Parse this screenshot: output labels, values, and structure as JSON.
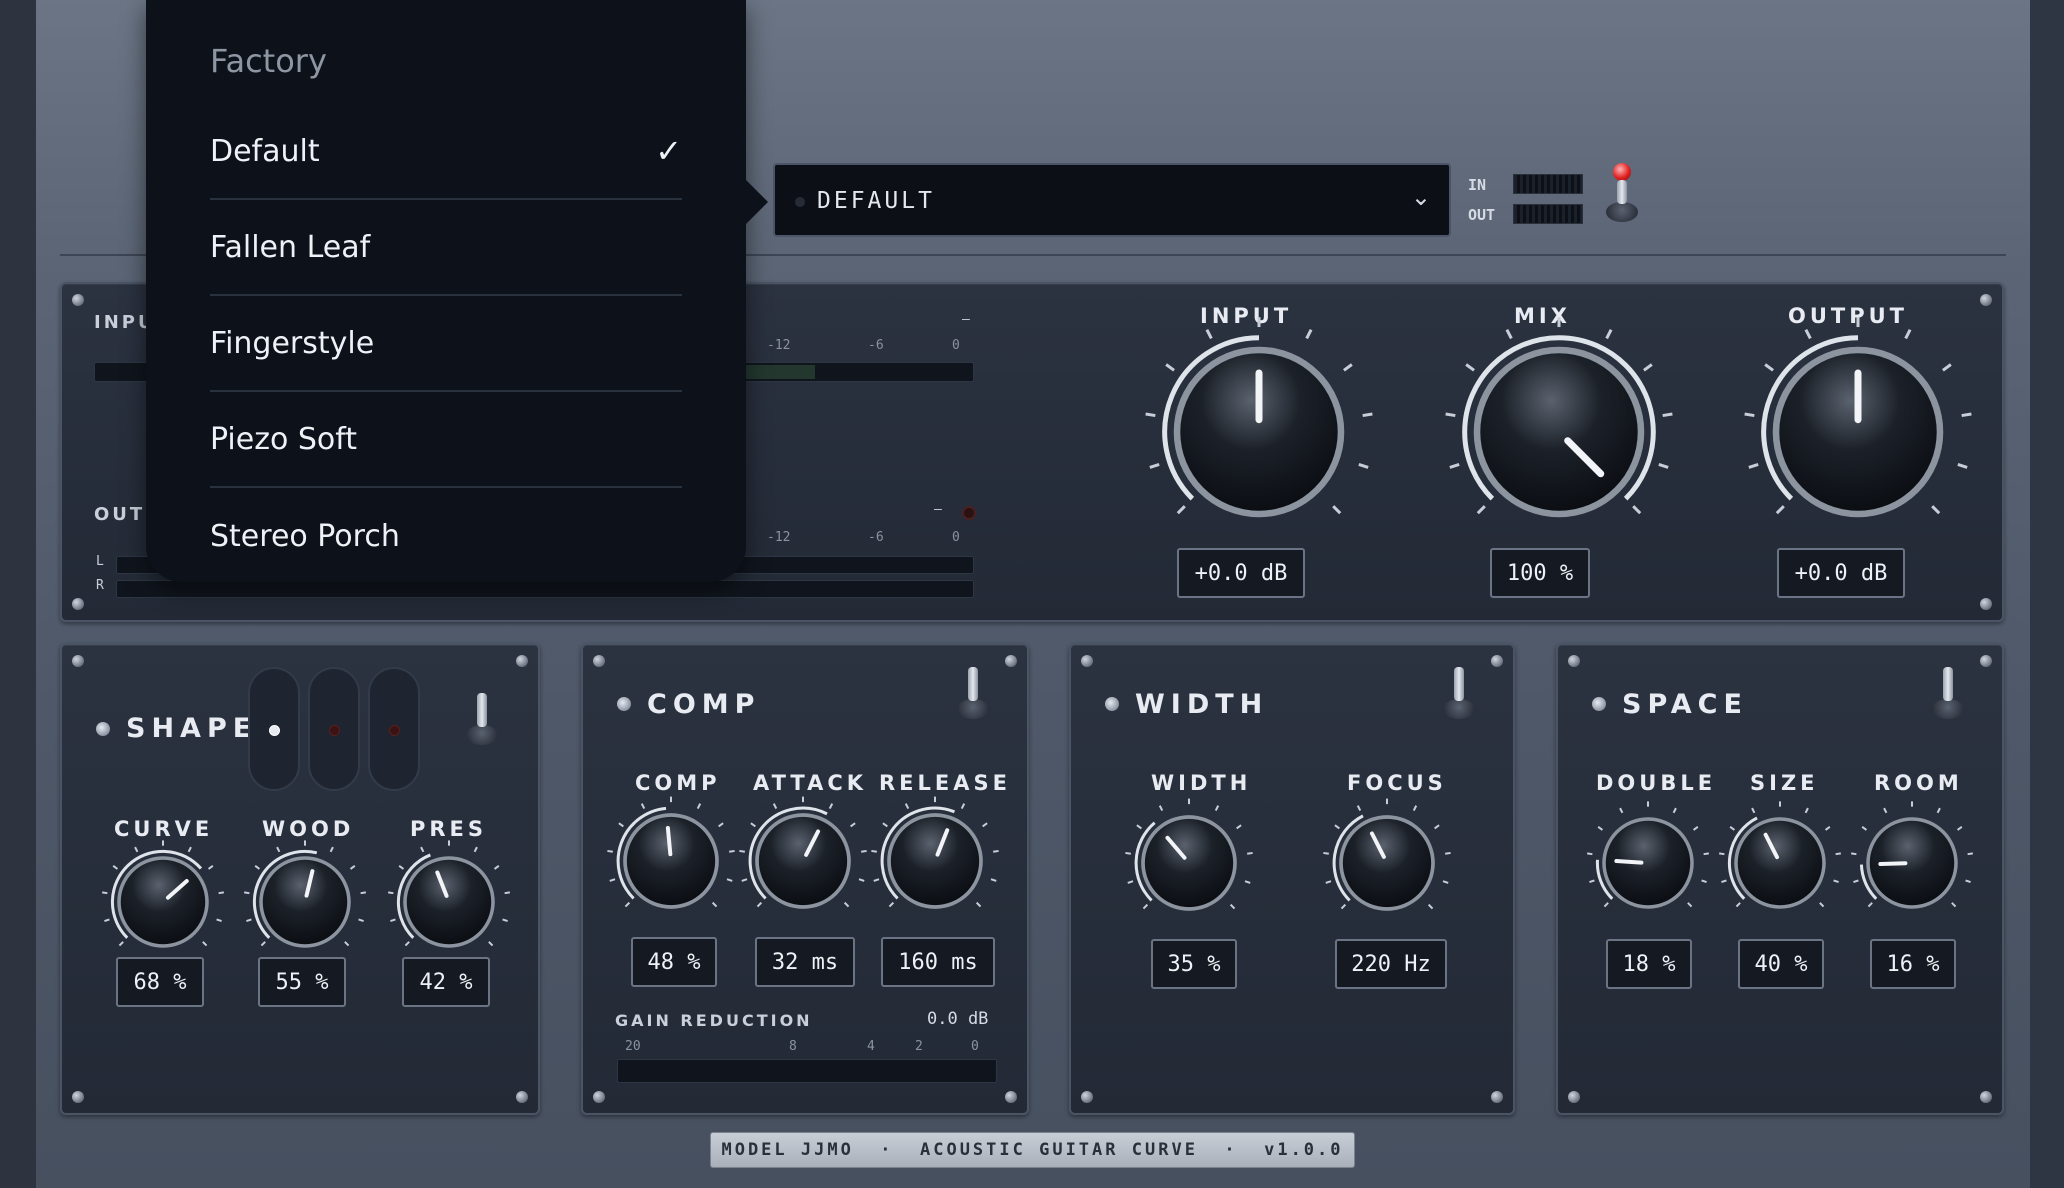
{
  "preset_menu": {
    "header": "Factory",
    "items": [
      {
        "label": "Default",
        "checked": true
      },
      {
        "label": "Fallen Leaf",
        "checked": false
      },
      {
        "label": "Fingerstyle",
        "checked": false
      },
      {
        "label": "Piezo Soft",
        "checked": false
      },
      {
        "label": "Stereo Porch",
        "checked": false
      }
    ],
    "check_glyph": "✓"
  },
  "preset_select": {
    "value": "DEFAULT",
    "icon": "chevron-down-icon"
  },
  "io": {
    "in_label": "IN",
    "out_label": "OUT"
  },
  "meters": {
    "input_label": "INPU",
    "output_label": "OUTP",
    "scale": [
      "-12",
      "-6",
      "0"
    ],
    "channels": [
      "L",
      "R"
    ],
    "dash": "—"
  },
  "main": {
    "input": {
      "label": "INPUT",
      "value": "+0.0 dB",
      "level": 0.5
    },
    "mix": {
      "label": "MIX",
      "value": "100 %",
      "level": 1.0
    },
    "output": {
      "label": "OUTPUT",
      "value": "+0.0 dB",
      "level": 0.5
    }
  },
  "shape": {
    "title": "SHAPE",
    "curve": {
      "label": "CURVE",
      "value": "68 %",
      "level": 0.68
    },
    "wood": {
      "label": "WOOD",
      "value": "55 %",
      "level": 0.55
    },
    "pres": {
      "label": "PRES",
      "value": "42 %",
      "level": 0.42
    }
  },
  "comp": {
    "title": "COMP",
    "comp": {
      "label": "COMP",
      "value": "48 %",
      "level": 0.48
    },
    "attack": {
      "label": "ATTACK",
      "value": "32 ms",
      "level": 0.6
    },
    "release": {
      "label": "RELEASE",
      "value": "160 ms",
      "level": 0.58
    },
    "gr_label": "GAIN REDUCTION",
    "gr_value": "0.0 dB",
    "gr_scale": [
      "20",
      "8",
      "4",
      "2",
      "0"
    ]
  },
  "width": {
    "title": "WIDTH",
    "width": {
      "label": "WIDTH",
      "value": "35 %",
      "level": 0.35
    },
    "focus": {
      "label": "FOCUS",
      "value": "220 Hz",
      "level": 0.4
    }
  },
  "space": {
    "title": "SPACE",
    "double": {
      "label": "DOUBLE",
      "value": "18 %",
      "level": 0.18
    },
    "size": {
      "label": "SIZE",
      "value": "40 %",
      "level": 0.4
    },
    "room": {
      "label": "ROOM",
      "value": "16 %",
      "level": 0.16
    }
  },
  "footer": "MODEL JJMO  ·  ACOUSTIC GUITAR CURVE  ·  v1.0.0",
  "colors": {
    "accent_led": "#e02020",
    "panel": "#232a36",
    "text": "#e8ecf2"
  }
}
